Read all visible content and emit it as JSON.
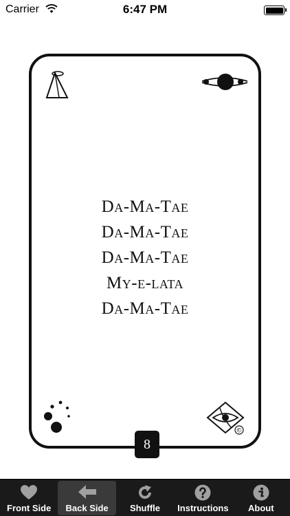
{
  "status_bar": {
    "carrier": "Carrier",
    "time": "6:47 PM",
    "wifi_icon": "wifi-icon",
    "battery_icon": "battery-full-icon"
  },
  "card": {
    "mantra_lines": [
      "Da-Ma-Tae",
      "Da-Ma-Tae",
      "Da-Ma-Tae",
      "My-e-lata",
      "Da-Ma-Tae"
    ],
    "number": "8",
    "copyright": "©",
    "icons": {
      "top_left": "pyramid-halo-icon",
      "top_right": "planet-orbit-icon",
      "bottom_left": "dots-cluster-icon",
      "bottom_right": "eye-diamond-icon"
    }
  },
  "tab_bar": {
    "active_index": 1,
    "tabs": [
      {
        "label": "Front Side",
        "icon": "heart-icon"
      },
      {
        "label": "Back Side",
        "icon": "arrow-left-icon"
      },
      {
        "label": "Shuffle",
        "icon": "refresh-icon"
      },
      {
        "label": "Instructions",
        "icon": "question-icon"
      },
      {
        "label": "About",
        "icon": "info-icon"
      }
    ]
  },
  "colors": {
    "card_border": "#111111",
    "tab_bar_bg": "#1a1a1a",
    "tab_active_bg": "#3a3a3a",
    "tab_icon": "#a0a0a0"
  }
}
